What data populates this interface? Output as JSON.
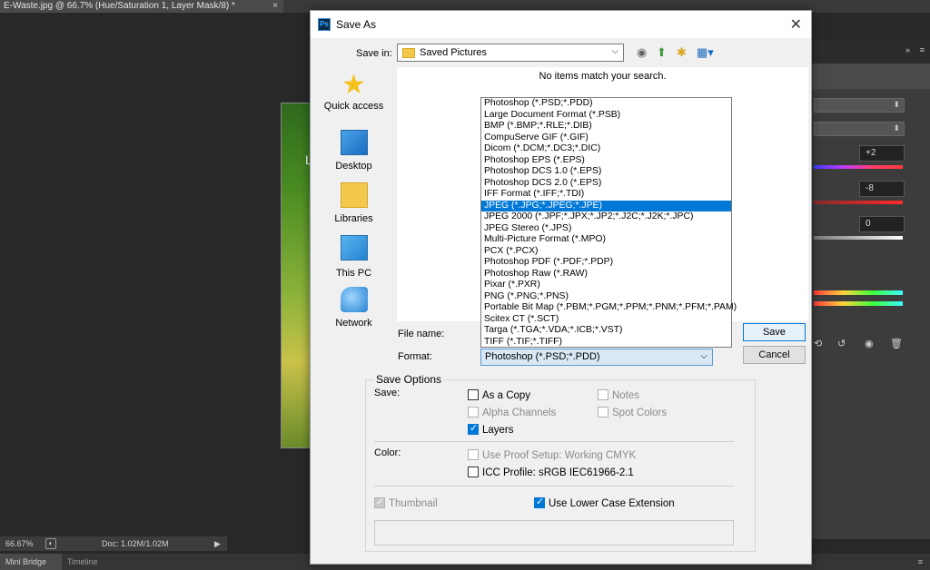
{
  "ps": {
    "doc_tab": "E-Waste.jpg @ 66.7% (Hue/Saturation 1, Layer Mask/8) *",
    "doc_close": "×",
    "canvas_char": "L",
    "zoom": "66.67%",
    "doc_info": "Doc: 1.02M/1.02M",
    "bottom_tab_active": "Mini Bridge",
    "bottom_tab": "Timeline",
    "panel_values": [
      "+2",
      "-8",
      "0"
    ],
    "panel_header_icon": "»",
    "panel_menu_icon": "≡"
  },
  "dialog": {
    "title": "Save As",
    "close": "✕",
    "save_in_label": "Save in:",
    "save_in_value": "Saved Pictures",
    "empty_message": "No items match your search.",
    "places": [
      {
        "label": "Quick access",
        "icon": "star-icon"
      },
      {
        "label": "Desktop",
        "icon": "desktop-icon"
      },
      {
        "label": "Libraries",
        "icon": "libraries-icon"
      },
      {
        "label": "This PC",
        "icon": "computer-icon"
      },
      {
        "label": "Network",
        "icon": "network-icon"
      }
    ],
    "file_name_label": "File name:",
    "format_label": "Format:",
    "format_value": "Photoshop (*.PSD;*.PDD)",
    "format_options": [
      "Photoshop (*.PSD;*.PDD)",
      "Large Document Format (*.PSB)",
      "BMP (*.BMP;*.RLE;*.DIB)",
      "CompuServe GIF (*.GIF)",
      "Dicom (*.DCM;*.DC3;*.DIC)",
      "Photoshop EPS (*.EPS)",
      "Photoshop DCS 1.0 (*.EPS)",
      "Photoshop DCS 2.0 (*.EPS)",
      "IFF Format (*.IFF;*.TDI)",
      "JPEG (*.JPG;*.JPEG;*.JPE)",
      "JPEG 2000 (*.JPF;*.JPX;*.JP2;*.J2C;*.J2K;*.JPC)",
      "JPEG Stereo (*.JPS)",
      "Multi-Picture Format (*.MPO)",
      "PCX (*.PCX)",
      "Photoshop PDF (*.PDF;*.PDP)",
      "Photoshop Raw (*.RAW)",
      "Pixar (*.PXR)",
      "PNG (*.PNG;*.PNS)",
      "Portable Bit Map (*.PBM;*.PGM;*.PPM;*.PNM;*.PFM;*.PAM)",
      "Scitex CT (*.SCT)",
      "Targa (*.TGA;*.VDA;*.ICB;*.VST)",
      "TIFF (*.TIF;*.TIFF)"
    ],
    "selected_format_index": 9,
    "save_button": "Save",
    "cancel_button": "Cancel",
    "save_options_title": "Save Options",
    "save_label": "Save:",
    "color_label": "Color:",
    "checkboxes": {
      "as_a_copy": {
        "label": "As a Copy",
        "checked": false,
        "enabled": true
      },
      "notes": {
        "label": "Notes",
        "checked": false,
        "enabled": false
      },
      "alpha_channels": {
        "label": "Alpha Channels",
        "checked": false,
        "enabled": false
      },
      "spot_colors": {
        "label": "Spot Colors",
        "checked": false,
        "enabled": false
      },
      "layers": {
        "label": "Layers",
        "checked": true,
        "enabled": true
      },
      "use_proof_setup": {
        "label": "Use Proof Setup:  Working CMYK",
        "checked": false,
        "enabled": false
      },
      "icc_profile": {
        "label": "ICC Profile:  sRGB IEC61966-2.1",
        "checked": false,
        "enabled": true
      },
      "thumbnail": {
        "label": "Thumbnail",
        "checked": true,
        "enabled": false
      },
      "lower_case_ext": {
        "label": "Use Lower Case Extension",
        "checked": true,
        "enabled": true
      }
    }
  }
}
